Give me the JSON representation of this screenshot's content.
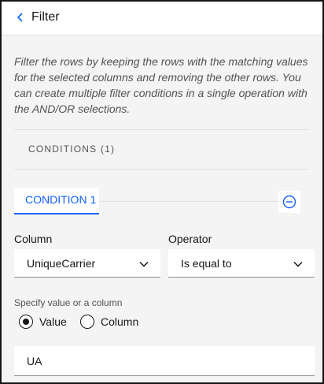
{
  "header": {
    "title": "Filter",
    "back_icon": "chevron-left-icon"
  },
  "description": "Filter the rows by keeping the rows with the matching values for the selected columns and removing the other rows. You can create multiple filter conditions in a single operation with the AND/OR selections.",
  "conditions": {
    "section_label": "CONDITIONS (1)",
    "tabs": [
      {
        "label": "CONDITION 1"
      }
    ],
    "remove_icon": "minus-circle-icon"
  },
  "column": {
    "label": "Column",
    "value": "UniqueCarrier"
  },
  "operator": {
    "label": "Operator",
    "value": "Is equal to"
  },
  "value_source": {
    "label": "Specify value or a column",
    "options": [
      {
        "label": "Value",
        "selected": true
      },
      {
        "label": "Column",
        "selected": false
      }
    ]
  },
  "value_input": {
    "value": "UA"
  },
  "colors": {
    "accent": "#0f62fe",
    "text": "#161616",
    "muted": "#525252",
    "background": "#f4f4f4"
  }
}
